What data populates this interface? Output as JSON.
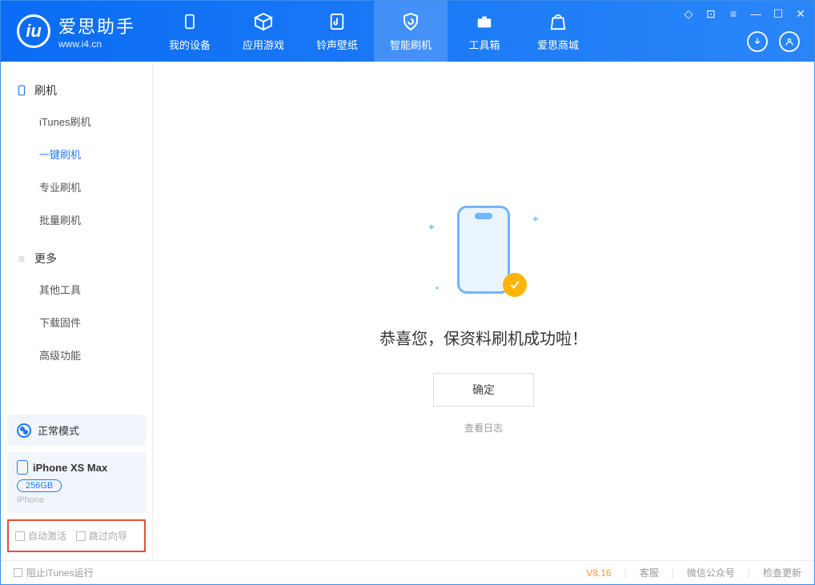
{
  "app": {
    "title": "爱思助手",
    "subtitle": "www.i4.cn"
  },
  "tabs": [
    {
      "label": "我的设备"
    },
    {
      "label": "应用游戏"
    },
    {
      "label": "铃声壁纸"
    },
    {
      "label": "智能刷机"
    },
    {
      "label": "工具箱"
    },
    {
      "label": "爱思商城"
    }
  ],
  "sidebar": {
    "section1": {
      "head": "刷机",
      "items": [
        "iTunes刷机",
        "一键刷机",
        "专业刷机",
        "批量刷机"
      ]
    },
    "section2": {
      "head": "更多",
      "items": [
        "其他工具",
        "下载固件",
        "高级功能"
      ]
    }
  },
  "mode": {
    "label": "正常模式"
  },
  "device": {
    "name": "iPhone XS Max",
    "storage": "256GB",
    "type": "iPhone"
  },
  "checks": {
    "auto_activate": "自动激活",
    "skip_guide": "跳过向导"
  },
  "main": {
    "congrats": "恭喜您，保资料刷机成功啦！",
    "ok": "确定",
    "loglink": "查看日志"
  },
  "footer": {
    "block_itunes": "阻止iTunes运行",
    "version": "V8.16",
    "links": [
      "客服",
      "微信公众号",
      "检查更新"
    ]
  }
}
